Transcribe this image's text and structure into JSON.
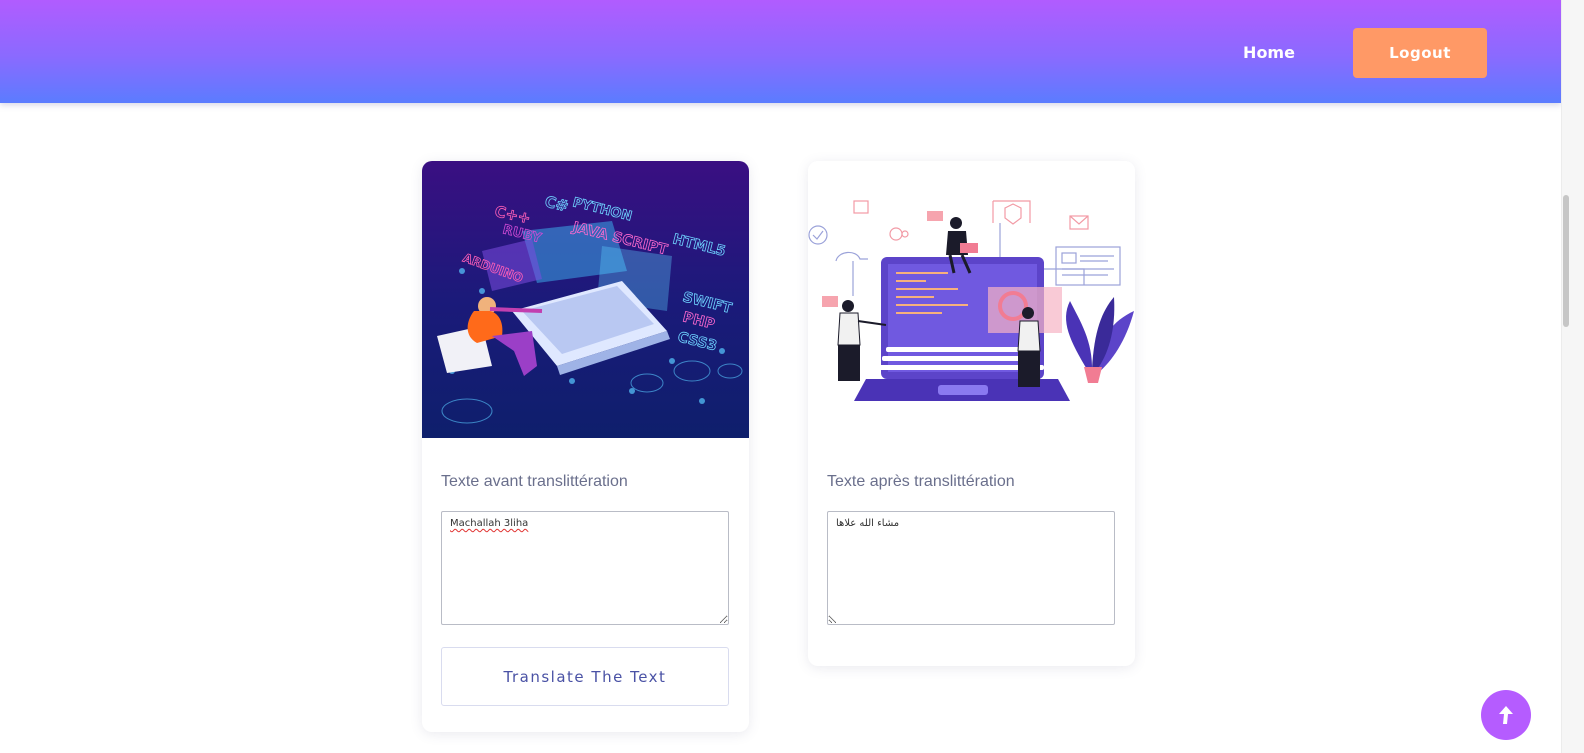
{
  "nav": {
    "home_label": "Home",
    "logout_label": "Logout"
  },
  "cards": [
    {
      "label": "Texte avant translittération",
      "textarea_value": "Machallah 3liha",
      "button_label": "Translate The Text"
    },
    {
      "label": "Texte après translittération",
      "textarea_value": "مشاء الله علاها"
    }
  ],
  "images": {
    "left": [
      "C++",
      "C#",
      "RUBY",
      "PYTHON",
      "JAVA SCRIPT",
      "HTML5",
      "ARDUINO",
      "SWIFT",
      "PHP",
      "CSS3"
    ]
  },
  "colors": {
    "header_top": "#b15cff",
    "header_bottom": "#5b7cff",
    "logout_bg": "#ff9966",
    "back_top_bg": "#b55cff",
    "label_text": "#6a6f8c",
    "button_text": "#4a52a5"
  },
  "icons": {
    "back_to_top": "arrow-up-icon"
  }
}
